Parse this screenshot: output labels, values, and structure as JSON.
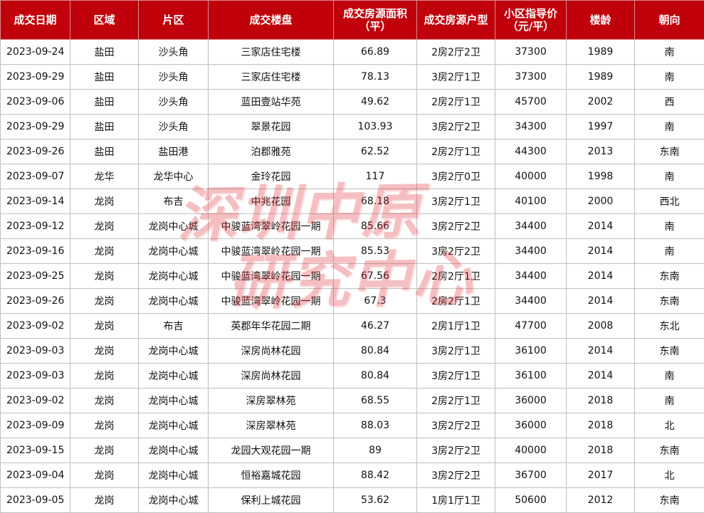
{
  "columns": [
    "成交日期",
    "区域",
    "片区",
    "成交楼盘",
    "成交房源面积\n（平）",
    "成交房源户型",
    "小区指导价\n（元/平）",
    "楼龄",
    "朝向"
  ],
  "rows": [
    [
      "2023-09-24",
      "盐田",
      "沙头角",
      "三家店住宅楼",
      "66.89",
      "2房2厅2卫",
      "37300",
      "1989",
      "南"
    ],
    [
      "2023-09-29",
      "盐田",
      "沙头角",
      "三家店住宅楼",
      "78.13",
      "3房2厅1卫",
      "37300",
      "1989",
      "南"
    ],
    [
      "2023-09-06",
      "盐田",
      "沙头角",
      "蓝田壹站华苑",
      "49.62",
      "2房2厅1卫",
      "45700",
      "2002",
      "西"
    ],
    [
      "2023-09-29",
      "盐田",
      "沙头角",
      "翠景花园",
      "103.93",
      "3房2厅2卫",
      "34300",
      "1997",
      "南"
    ],
    [
      "2023-09-26",
      "盐田",
      "盐田港",
      "泊郡雅苑",
      "62.52",
      "2房2厅1卫",
      "44300",
      "2013",
      "东南"
    ],
    [
      "2023-09-07",
      "龙华",
      "龙华中心",
      "金玲花园",
      "117",
      "3房2厅0卫",
      "40000",
      "1998",
      "南"
    ],
    [
      "2023-09-14",
      "龙岗",
      "布吉",
      "中兆花园",
      "68.18",
      "3房2厅1卫",
      "40100",
      "2000",
      "西北"
    ],
    [
      "2023-09-12",
      "龙岗",
      "龙岗中心城",
      "中骏蓝湾翠岭花园一期",
      "85.66",
      "3房2厅2卫",
      "34400",
      "2014",
      "南"
    ],
    [
      "2023-09-16",
      "龙岗",
      "龙岗中心城",
      "中骏蓝湾翠岭花园一期",
      "85.53",
      "3房2厅2卫",
      "34400",
      "2014",
      "南"
    ],
    [
      "2023-09-25",
      "龙岗",
      "龙岗中心城",
      "中骏蓝湾翠岭花园一期",
      "67.56",
      "2房2厅1卫",
      "34400",
      "2014",
      "东南"
    ],
    [
      "2023-09-26",
      "龙岗",
      "龙岗中心城",
      "中骏蓝湾翠岭花园一期",
      "67.3",
      "2房2厅1卫",
      "34400",
      "2014",
      "东南"
    ],
    [
      "2023-09-02",
      "龙岗",
      "布吉",
      "英郡年华花园二期",
      "46.27",
      "2房1厅1卫",
      "47700",
      "2008",
      "东北"
    ],
    [
      "2023-09-03",
      "龙岗",
      "龙岗中心城",
      "深房尚林花园",
      "80.84",
      "3房2厅1卫",
      "36100",
      "2014",
      "东南"
    ],
    [
      "2023-09-03",
      "龙岗",
      "龙岗中心城",
      "深房尚林花园",
      "80.84",
      "3房2厅1卫",
      "36100",
      "2014",
      "南"
    ],
    [
      "2023-09-02",
      "龙岗",
      "龙岗中心城",
      "深房翠林苑",
      "68.55",
      "2房2厅1卫",
      "36000",
      "2018",
      "南"
    ],
    [
      "2023-09-09",
      "龙岗",
      "龙岗中心城",
      "深房翠林苑",
      "88.03",
      "3房2厅2卫",
      "36000",
      "2018",
      "北"
    ],
    [
      "2023-09-15",
      "龙岗",
      "龙岗中心城",
      "龙园大观花园一期",
      "89",
      "3房2厅2卫",
      "40000",
      "2018",
      "东南"
    ],
    [
      "2023-09-04",
      "龙岗",
      "龙岗中心城",
      "恒裕嘉城花园",
      "88.42",
      "3房2厅2卫",
      "36700",
      "2017",
      "北"
    ],
    [
      "2023-09-05",
      "龙岗",
      "龙岗中心城",
      "保利上城花园",
      "53.62",
      "1房1厅1卫",
      "50600",
      "2012",
      "东南"
    ]
  ],
  "watermark": {
    "line1": "深圳中原",
    "line2": "研究中心"
  },
  "colors": {
    "header_bg": "#c0000b",
    "header_text": "#ffffff",
    "grid": "#bfbfbf",
    "watermark": "#e0303a"
  }
}
